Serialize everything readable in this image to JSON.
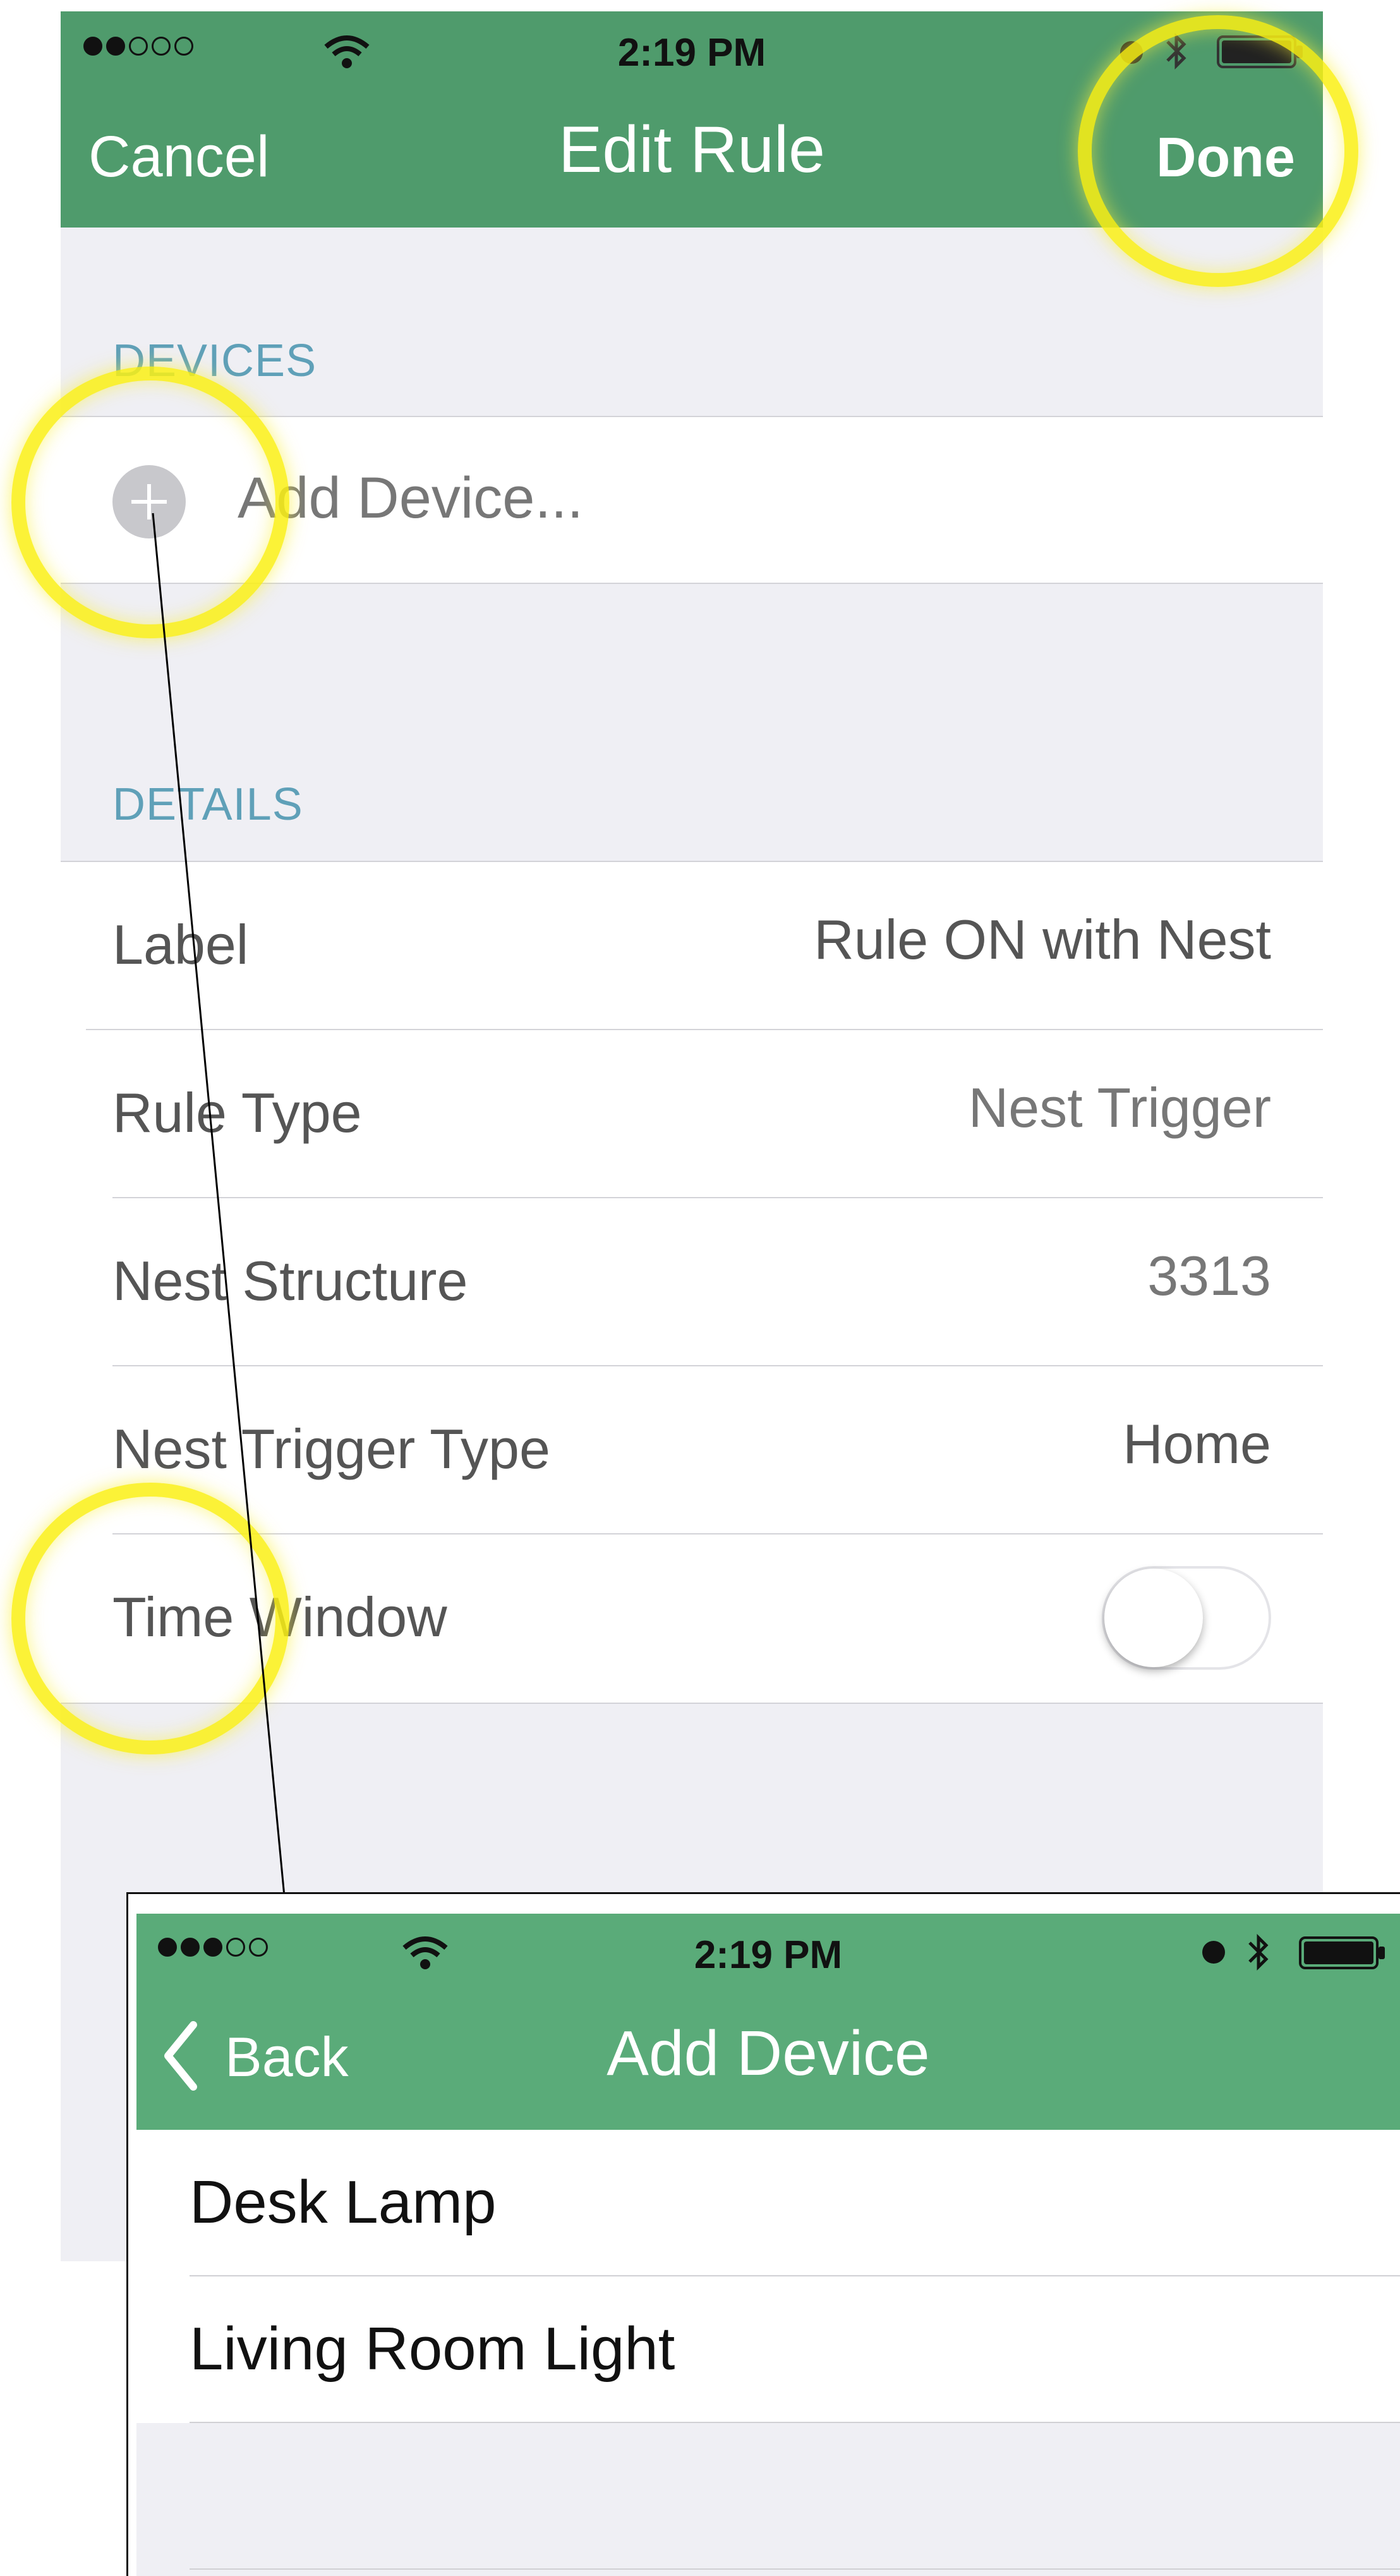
{
  "main_screen": {
    "status": {
      "time": "2:19 PM",
      "signal_dots": [
        true,
        true,
        false,
        false,
        false
      ]
    },
    "nav": {
      "title": "Edit Rule",
      "cancel_label": "Cancel",
      "done_label": "Done"
    },
    "devices_section": {
      "header": "DEVICES",
      "add_device_label": "Add Device..."
    },
    "details_section": {
      "header": "DETAILS",
      "rows": [
        {
          "label": "Label",
          "value": "Rule ON with Nest"
        },
        {
          "label": "Rule Type",
          "value": "Nest Trigger"
        },
        {
          "label": "Nest Structure",
          "value": "3313"
        },
        {
          "label": "Nest Trigger Type",
          "value": "Home"
        },
        {
          "label": "Time Window",
          "value": ""
        }
      ],
      "time_window_enabled": false
    }
  },
  "inset_screen": {
    "status": {
      "time": "2:19 PM",
      "signal_dots": [
        true,
        true,
        true,
        false,
        false
      ]
    },
    "nav": {
      "title": "Add Device",
      "back_label": "Back"
    },
    "devices": [
      "Desk Lamp",
      "Living Room Light"
    ]
  },
  "colors": {
    "nav_green": "#4f9b6c",
    "nav_green_inset": "#5aab79",
    "section_header": "#5fa0b8",
    "highlight": "#f6ea1a"
  }
}
